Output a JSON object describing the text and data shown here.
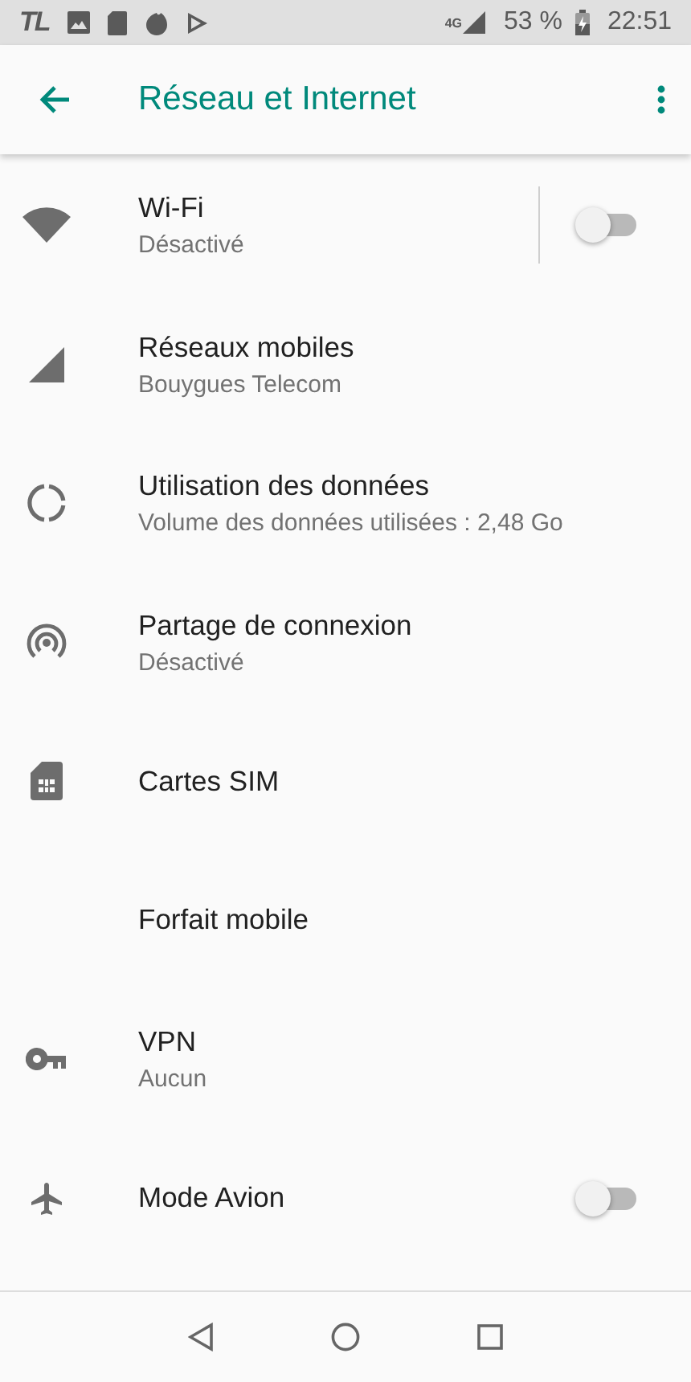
{
  "status_bar": {
    "app_label": "TL",
    "network": "4G",
    "battery": "53 %",
    "time": "22:51"
  },
  "app_bar": {
    "title": "Réseau et Internet"
  },
  "items": [
    {
      "kind": "toggle",
      "title": "Wi-Fi",
      "subtitle": "Désactivé",
      "on": false
    },
    {
      "kind": "plain",
      "title": "Réseaux mobiles",
      "subtitle": "Bouygues Telecom"
    },
    {
      "kind": "plain",
      "title": "Utilisation des données",
      "subtitle": "Volume des données utilisées : 2,48 Go"
    },
    {
      "kind": "plain",
      "title": "Partage de connexion",
      "subtitle": "Désactivé"
    },
    {
      "kind": "plain",
      "title": "Cartes SIM"
    },
    {
      "kind": "plain",
      "title": "Forfait mobile"
    },
    {
      "kind": "plain",
      "title": "VPN",
      "subtitle": "Aucun"
    },
    {
      "kind": "toggle",
      "title": "Mode Avion",
      "on": false
    }
  ]
}
